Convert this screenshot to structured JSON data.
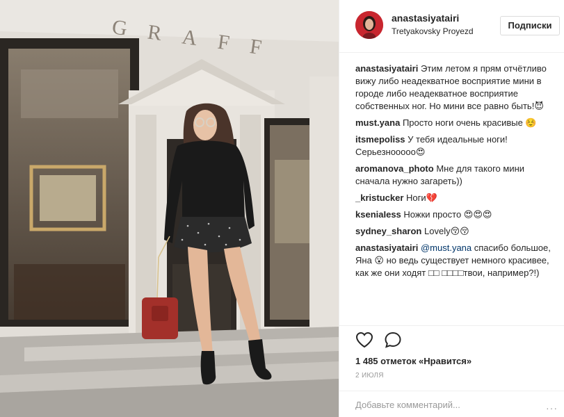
{
  "post": {
    "photo_facade_text": "GRAFF"
  },
  "header": {
    "username": "anastasiyatairi",
    "location": "Tretyakovsky Proyezd",
    "follow_label": "Подписки"
  },
  "comments": [
    {
      "user": "anastasiyatairi",
      "mention": "",
      "text": "Этим летом я прям отчётливо вижу либо неадекватное восприятие мини в городе либо неадекватное восприятие собственных ног. Но мини все равно быть!😈"
    },
    {
      "user": "must.yana",
      "mention": "",
      "text": "Просто ноги очень красивые ☺️"
    },
    {
      "user": "itsmepoliss",
      "mention": "",
      "text": "У тебя идеальные ноги! Серьезнооооо😍"
    },
    {
      "user": "aromanova_photo",
      "mention": "",
      "text": "Мне для такого мини сначала нужно загареть))"
    },
    {
      "user": "_kristucker",
      "mention": "",
      "text": "Ноги💔"
    },
    {
      "user": "kseniaIess",
      "mention": "",
      "text": "Ножки просто 😍😍😍"
    },
    {
      "user": "sydney_sharon",
      "mention": "",
      "text": "Lovely😚😚"
    },
    {
      "user": "anastasiyatairi",
      "mention": "@must.yana",
      "text": "спасибо большое, Яна 😮 но ведь существует немного красивее, как же они ходят □□ □□□□твои, например?!)"
    }
  ],
  "actions": {
    "like_icon": "heart-icon",
    "comment_icon": "speech-bubble-icon"
  },
  "likes": "1 485 отметок «Нравится»",
  "date": "2 ИЮЛЯ",
  "add_comment": {
    "placeholder": "Добавьте комментарий...",
    "more_label": "···"
  },
  "colors": {
    "text": "#262626",
    "muted": "#999999",
    "border": "#efefef",
    "mention": "#003569",
    "avatar_bg": "#c8262f"
  }
}
